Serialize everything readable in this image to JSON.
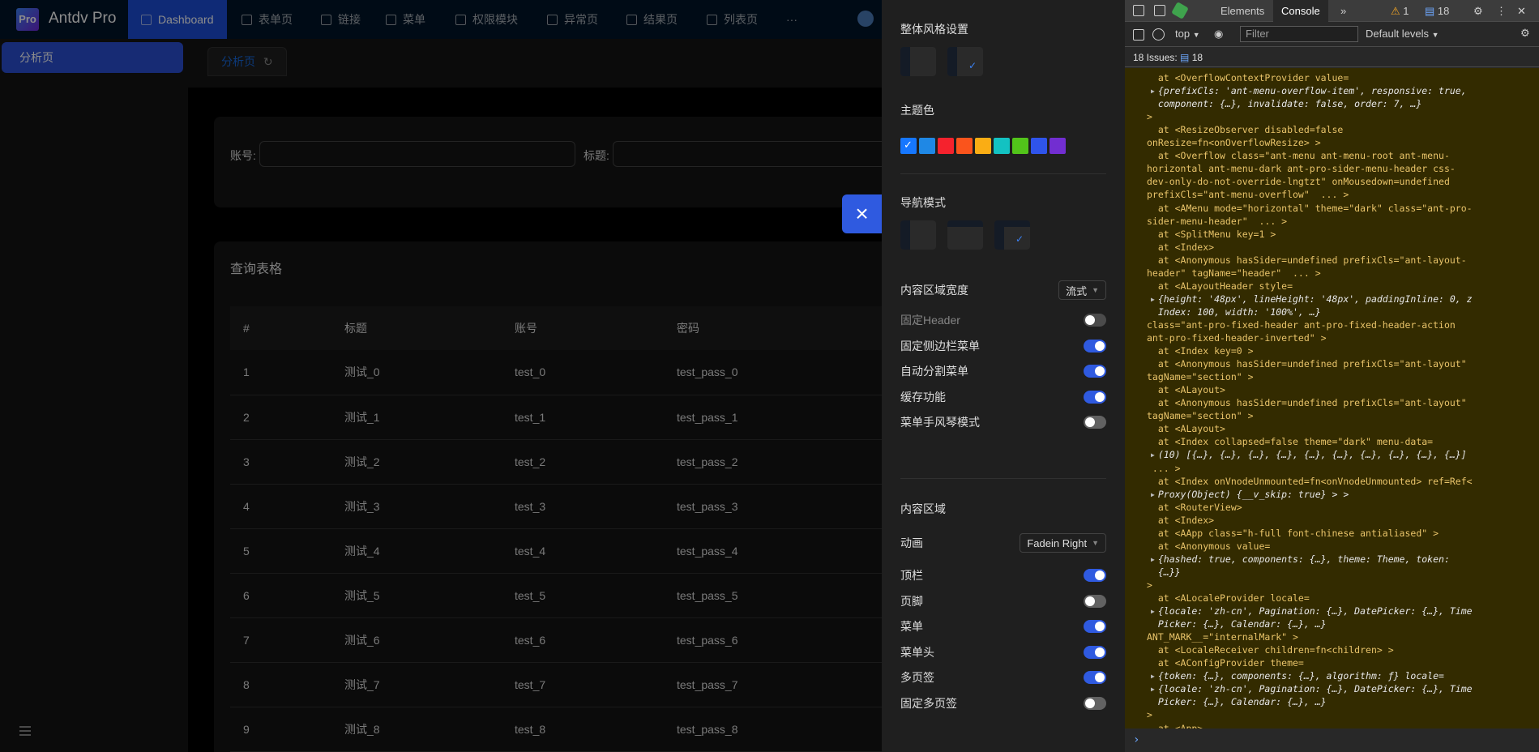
{
  "app": {
    "brand": "Antdv Pro",
    "logo": "Pro",
    "nav": [
      {
        "label": "Dashboard",
        "icon": "dashboard-icon"
      },
      {
        "label": "表单页",
        "icon": "edit-icon"
      },
      {
        "label": "链接",
        "icon": "link-icon"
      },
      {
        "label": "菜单",
        "icon": "menu-icon"
      },
      {
        "label": "权限模块",
        "icon": "bank-icon"
      },
      {
        "label": "异常页",
        "icon": "warning-icon"
      },
      {
        "label": "结果页",
        "icon": "check-circle-icon"
      },
      {
        "label": "列表页",
        "icon": "table-icon"
      },
      {
        "label": "···",
        "icon": "ellipsis-icon"
      }
    ],
    "sider_item": "分析页",
    "tab_label": "分析页",
    "search": {
      "account_label": "账号:",
      "title_label": "标题:"
    },
    "table_title": "查询表格",
    "columns": [
      "#",
      "标题",
      "账号",
      "密码"
    ],
    "rows": [
      [
        "1",
        "测试_0",
        "test_0",
        "test_pass_0"
      ],
      [
        "2",
        "测试_1",
        "test_1",
        "test_pass_1"
      ],
      [
        "3",
        "测试_2",
        "test_2",
        "test_pass_2"
      ],
      [
        "4",
        "测试_3",
        "test_3",
        "test_pass_3"
      ],
      [
        "5",
        "测试_4",
        "test_4",
        "test_pass_4"
      ],
      [
        "6",
        "测试_5",
        "test_5",
        "test_pass_5"
      ],
      [
        "7",
        "测试_6",
        "test_6",
        "test_pass_6"
      ],
      [
        "8",
        "测试_7",
        "test_7",
        "test_pass_7"
      ],
      [
        "9",
        "测试_8",
        "test_8",
        "test_pass_8"
      ]
    ]
  },
  "drawer": {
    "style_title": "整体风格设置",
    "theme_title": "主题色",
    "theme_colors": [
      "#1677ff",
      "#1f88e5",
      "#f5222d",
      "#fa541c",
      "#faad14",
      "#13c2c2",
      "#52c41a",
      "#2f54eb",
      "#722ed1"
    ],
    "nav_title": "导航模式",
    "content_width_label": "内容区域宽度",
    "content_width_value": "流式",
    "settings": [
      {
        "label": "固定Header",
        "on": false,
        "disabled": true
      },
      {
        "label": "固定侧边栏菜单",
        "on": true
      },
      {
        "label": "自动分割菜单",
        "on": true
      },
      {
        "label": "缓存功能",
        "on": true
      },
      {
        "label": "菜单手风琴模式",
        "on": false
      }
    ],
    "content_area_title": "内容区域",
    "animation_label": "动画",
    "animation_value": "Fadein Right",
    "content_settings": [
      {
        "label": "顶栏",
        "on": true
      },
      {
        "label": "页脚",
        "on": false
      },
      {
        "label": "菜单",
        "on": true
      },
      {
        "label": "菜单头",
        "on": true
      },
      {
        "label": "多页签",
        "on": true
      },
      {
        "label": "固定多页签",
        "on": false
      }
    ]
  },
  "devtools": {
    "tabs": [
      "Elements",
      "Console"
    ],
    "warnings": "1",
    "messages": "18",
    "context": "top",
    "filter_placeholder": "Filter",
    "levels": "Default levels",
    "issues_label": "18 Issues:",
    "issues_count": "18",
    "lines": [
      {
        "t": "  at <OverflowContextProvider value=",
        "k": "log"
      },
      {
        "t": "  {prefixCls: 'ant-menu-overflow-item', responsive: true,",
        "k": "obj",
        "tri": true
      },
      {
        "t": "  component: {…}, invalidate: false, order: 7, …}",
        "k": "obj"
      },
      {
        "t": ">",
        "k": "log"
      },
      {
        "t": "  at <ResizeObserver disabled=false",
        "k": "log"
      },
      {
        "t": "onResize=fn<onOverflowResize> >",
        "k": "log"
      },
      {
        "t": "  at <Overflow class=\"ant-menu ant-menu-root ant-menu-",
        "k": "log"
      },
      {
        "t": "horizontal ant-menu-dark ant-pro-sider-menu-header css-",
        "k": "log"
      },
      {
        "t": "dev-only-do-not-override-lngtzt\" onMousedown=undefined",
        "k": "log"
      },
      {
        "t": "prefixCls=\"ant-menu-overflow\"  ... >",
        "k": "log"
      },
      {
        "t": "  at <AMenu mode=\"horizontal\" theme=\"dark\" class=\"ant-pro-",
        "k": "log"
      },
      {
        "t": "sider-menu-header\"  ... >",
        "k": "log"
      },
      {
        "t": "  at <SplitMenu key=1 >",
        "k": "log"
      },
      {
        "t": "  at <Index>",
        "k": "log"
      },
      {
        "t": "  at <Anonymous hasSider=undefined prefixCls=\"ant-layout-",
        "k": "log"
      },
      {
        "t": "header\" tagName=\"header\"  ... >",
        "k": "log"
      },
      {
        "t": "  at <ALayoutHeader style=",
        "k": "log"
      },
      {
        "t": "  {height: '48px', lineHeight: '48px', paddingInline: 0, z",
        "k": "obj",
        "tri": true
      },
      {
        "t": "  Index: 100, width: '100%', …}",
        "k": "obj"
      },
      {
        "t": "class=\"ant-pro-fixed-header ant-pro-fixed-header-action",
        "k": "log"
      },
      {
        "t": "ant-pro-fixed-header-inverted\" >",
        "k": "log"
      },
      {
        "t": "  at <Index key=0 >",
        "k": "log"
      },
      {
        "t": "  at <Anonymous hasSider=undefined prefixCls=\"ant-layout\"",
        "k": "log"
      },
      {
        "t": "tagName=\"section\" >",
        "k": "log"
      },
      {
        "t": "  at <ALayout>",
        "k": "log"
      },
      {
        "t": "  at <Anonymous hasSider=undefined prefixCls=\"ant-layout\"",
        "k": "log"
      },
      {
        "t": "tagName=\"section\" >",
        "k": "log"
      },
      {
        "t": "  at <ALayout>",
        "k": "log"
      },
      {
        "t": "  at <Index collapsed=false theme=\"dark\" menu-data=",
        "k": "log"
      },
      {
        "t": "  (10) [{…}, {…}, {…}, {…}, {…}, {…}, {…}, {…}, {…}, {…}]",
        "k": "obj",
        "tri": true
      },
      {
        "t": " ... >",
        "k": "log"
      },
      {
        "t": "  at <Index onVnodeUnmounted=fn<onVnodeUnmounted> ref=Ref<",
        "k": "log"
      },
      {
        "t": "  Proxy(Object) {__v_skip: true} > >",
        "k": "obj",
        "tri": true
      },
      {
        "t": "  at <RouterView>",
        "k": "log"
      },
      {
        "t": "  at <Index>",
        "k": "log"
      },
      {
        "t": "  at <AApp class=\"h-full font-chinese antialiased\" >",
        "k": "log"
      },
      {
        "t": "  at <Anonymous value=",
        "k": "log"
      },
      {
        "t": "  {hashed: true, components: {…}, theme: Theme, token:",
        "k": "obj",
        "tri": true
      },
      {
        "t": "  {…}}",
        "k": "obj"
      },
      {
        "t": ">",
        "k": "log"
      },
      {
        "t": "  at <ALocaleProvider locale=",
        "k": "log"
      },
      {
        "t": "  {locale: 'zh-cn', Pagination: {…}, DatePicker: {…}, Time",
        "k": "obj",
        "tri": true
      },
      {
        "t": "  Picker: {…}, Calendar: {…}, …}",
        "k": "obj"
      },
      {
        "t": "ANT_MARK__=\"internalMark\" >",
        "k": "log"
      },
      {
        "t": "  at <LocaleReceiver children=fn<children> >",
        "k": "log"
      },
      {
        "t": "  at <AConfigProvider theme=",
        "k": "log"
      },
      {
        "t": "  {token: {…}, components: {…}, algorithm: ƒ} locale=",
        "k": "obj",
        "tri": true
      },
      {
        "t": "  {locale: 'zh-cn', Pagination: {…}, DatePicker: {…}, Time",
        "k": "obj",
        "tri": true
      },
      {
        "t": "  Picker: {…}, Calendar: {…}, …}",
        "k": "obj"
      },
      {
        "t": ">",
        "k": "log"
      },
      {
        "t": "  at <App>",
        "k": "log"
      }
    ]
  }
}
